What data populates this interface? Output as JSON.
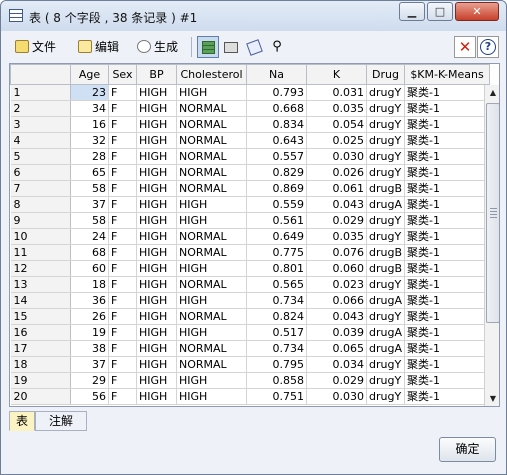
{
  "window": {
    "title": "表 ( 8 个字段 , 38 条记录 ) #1",
    "minimize_glyph": "▁",
    "maximize_glyph": "□",
    "close_glyph": "✕"
  },
  "menu": {
    "file": "文件",
    "edit": "编辑",
    "generate": "生成"
  },
  "toolbar_icons": [
    "table-view-icon",
    "print-icon",
    "export-icon",
    "find-icon",
    "close-x-icon",
    "help-icon"
  ],
  "table": {
    "columns": [
      "Age",
      "Sex",
      "BP",
      "Cholesterol",
      "Na",
      "K",
      "Drug",
      "$KM-K-Means"
    ],
    "rows": [
      [
        "1",
        "23",
        "F",
        "HIGH",
        "HIGH",
        "0.793",
        "0.031",
        "drugY",
        "聚类-1"
      ],
      [
        "2",
        "34",
        "F",
        "HIGH",
        "NORMAL",
        "0.668",
        "0.035",
        "drugY",
        "聚类-1"
      ],
      [
        "3",
        "16",
        "F",
        "HIGH",
        "NORMAL",
        "0.834",
        "0.054",
        "drugY",
        "聚类-1"
      ],
      [
        "4",
        "32",
        "F",
        "HIGH",
        "NORMAL",
        "0.643",
        "0.025",
        "drugY",
        "聚类-1"
      ],
      [
        "5",
        "28",
        "F",
        "HIGH",
        "NORMAL",
        "0.557",
        "0.030",
        "drugY",
        "聚类-1"
      ],
      [
        "6",
        "65",
        "F",
        "HIGH",
        "NORMAL",
        "0.829",
        "0.026",
        "drugY",
        "聚类-1"
      ],
      [
        "7",
        "58",
        "F",
        "HIGH",
        "NORMAL",
        "0.869",
        "0.061",
        "drugB",
        "聚类-1"
      ],
      [
        "8",
        "37",
        "F",
        "HIGH",
        "HIGH",
        "0.559",
        "0.043",
        "drugA",
        "聚类-1"
      ],
      [
        "9",
        "58",
        "F",
        "HIGH",
        "HIGH",
        "0.561",
        "0.029",
        "drugY",
        "聚类-1"
      ],
      [
        "10",
        "24",
        "F",
        "HIGH",
        "NORMAL",
        "0.649",
        "0.035",
        "drugY",
        "聚类-1"
      ],
      [
        "11",
        "68",
        "F",
        "HIGH",
        "NORMAL",
        "0.775",
        "0.076",
        "drugB",
        "聚类-1"
      ],
      [
        "12",
        "60",
        "F",
        "HIGH",
        "HIGH",
        "0.801",
        "0.060",
        "drugB",
        "聚类-1"
      ],
      [
        "13",
        "18",
        "F",
        "HIGH",
        "NORMAL",
        "0.565",
        "0.023",
        "drugY",
        "聚类-1"
      ],
      [
        "14",
        "36",
        "F",
        "HIGH",
        "HIGH",
        "0.734",
        "0.066",
        "drugA",
        "聚类-1"
      ],
      [
        "15",
        "26",
        "F",
        "HIGH",
        "NORMAL",
        "0.824",
        "0.043",
        "drugY",
        "聚类-1"
      ],
      [
        "16",
        "19",
        "F",
        "HIGH",
        "HIGH",
        "0.517",
        "0.039",
        "drugA",
        "聚类-1"
      ],
      [
        "17",
        "38",
        "F",
        "HIGH",
        "NORMAL",
        "0.734",
        "0.065",
        "drugA",
        "聚类-1"
      ],
      [
        "18",
        "37",
        "F",
        "HIGH",
        "NORMAL",
        "0.795",
        "0.034",
        "drugY",
        "聚类-1"
      ],
      [
        "19",
        "29",
        "F",
        "HIGH",
        "HIGH",
        "0.858",
        "0.029",
        "drugY",
        "聚类-1"
      ],
      [
        "20",
        "56",
        "F",
        "HIGH",
        "HIGH",
        "0.751",
        "0.030",
        "drugY",
        "聚类-1"
      ]
    ]
  },
  "tabs": [
    "表",
    "注解"
  ],
  "ok_button": "确定"
}
